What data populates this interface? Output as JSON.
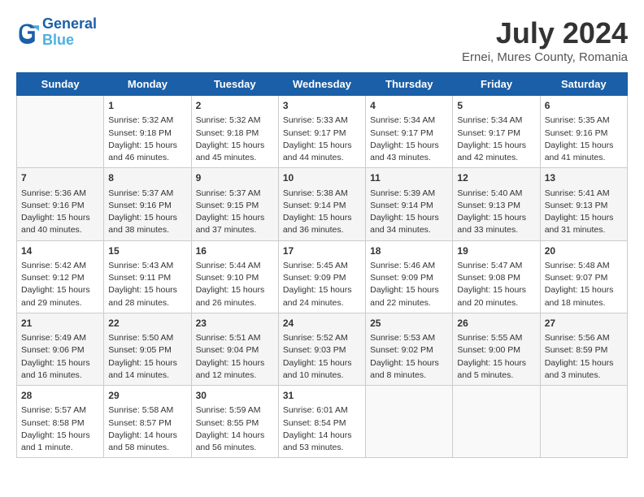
{
  "header": {
    "logo_line1": "General",
    "logo_line2": "Blue",
    "month_year": "July 2024",
    "location": "Ernei, Mures County, Romania"
  },
  "weekdays": [
    "Sunday",
    "Monday",
    "Tuesday",
    "Wednesday",
    "Thursday",
    "Friday",
    "Saturday"
  ],
  "weeks": [
    [
      {
        "day": "",
        "empty": true
      },
      {
        "day": "1",
        "sunrise": "5:32 AM",
        "sunset": "9:18 PM",
        "daylight": "15 hours and 46 minutes."
      },
      {
        "day": "2",
        "sunrise": "5:32 AM",
        "sunset": "9:18 PM",
        "daylight": "15 hours and 45 minutes."
      },
      {
        "day": "3",
        "sunrise": "5:33 AM",
        "sunset": "9:17 PM",
        "daylight": "15 hours and 44 minutes."
      },
      {
        "day": "4",
        "sunrise": "5:34 AM",
        "sunset": "9:17 PM",
        "daylight": "15 hours and 43 minutes."
      },
      {
        "day": "5",
        "sunrise": "5:34 AM",
        "sunset": "9:17 PM",
        "daylight": "15 hours and 42 minutes."
      },
      {
        "day": "6",
        "sunrise": "5:35 AM",
        "sunset": "9:16 PM",
        "daylight": "15 hours and 41 minutes."
      }
    ],
    [
      {
        "day": "7",
        "sunrise": "5:36 AM",
        "sunset": "9:16 PM",
        "daylight": "15 hours and 40 minutes."
      },
      {
        "day": "8",
        "sunrise": "5:37 AM",
        "sunset": "9:16 PM",
        "daylight": "15 hours and 38 minutes."
      },
      {
        "day": "9",
        "sunrise": "5:37 AM",
        "sunset": "9:15 PM",
        "daylight": "15 hours and 37 minutes."
      },
      {
        "day": "10",
        "sunrise": "5:38 AM",
        "sunset": "9:14 PM",
        "daylight": "15 hours and 36 minutes."
      },
      {
        "day": "11",
        "sunrise": "5:39 AM",
        "sunset": "9:14 PM",
        "daylight": "15 hours and 34 minutes."
      },
      {
        "day": "12",
        "sunrise": "5:40 AM",
        "sunset": "9:13 PM",
        "daylight": "15 hours and 33 minutes."
      },
      {
        "day": "13",
        "sunrise": "5:41 AM",
        "sunset": "9:13 PM",
        "daylight": "15 hours and 31 minutes."
      }
    ],
    [
      {
        "day": "14",
        "sunrise": "5:42 AM",
        "sunset": "9:12 PM",
        "daylight": "15 hours and 29 minutes."
      },
      {
        "day": "15",
        "sunrise": "5:43 AM",
        "sunset": "9:11 PM",
        "daylight": "15 hours and 28 minutes."
      },
      {
        "day": "16",
        "sunrise": "5:44 AM",
        "sunset": "9:10 PM",
        "daylight": "15 hours and 26 minutes."
      },
      {
        "day": "17",
        "sunrise": "5:45 AM",
        "sunset": "9:09 PM",
        "daylight": "15 hours and 24 minutes."
      },
      {
        "day": "18",
        "sunrise": "5:46 AM",
        "sunset": "9:09 PM",
        "daylight": "15 hours and 22 minutes."
      },
      {
        "day": "19",
        "sunrise": "5:47 AM",
        "sunset": "9:08 PM",
        "daylight": "15 hours and 20 minutes."
      },
      {
        "day": "20",
        "sunrise": "5:48 AM",
        "sunset": "9:07 PM",
        "daylight": "15 hours and 18 minutes."
      }
    ],
    [
      {
        "day": "21",
        "sunrise": "5:49 AM",
        "sunset": "9:06 PM",
        "daylight": "15 hours and 16 minutes."
      },
      {
        "day": "22",
        "sunrise": "5:50 AM",
        "sunset": "9:05 PM",
        "daylight": "15 hours and 14 minutes."
      },
      {
        "day": "23",
        "sunrise": "5:51 AM",
        "sunset": "9:04 PM",
        "daylight": "15 hours and 12 minutes."
      },
      {
        "day": "24",
        "sunrise": "5:52 AM",
        "sunset": "9:03 PM",
        "daylight": "15 hours and 10 minutes."
      },
      {
        "day": "25",
        "sunrise": "5:53 AM",
        "sunset": "9:02 PM",
        "daylight": "15 hours and 8 minutes."
      },
      {
        "day": "26",
        "sunrise": "5:55 AM",
        "sunset": "9:00 PM",
        "daylight": "15 hours and 5 minutes."
      },
      {
        "day": "27",
        "sunrise": "5:56 AM",
        "sunset": "8:59 PM",
        "daylight": "15 hours and 3 minutes."
      }
    ],
    [
      {
        "day": "28",
        "sunrise": "5:57 AM",
        "sunset": "8:58 PM",
        "daylight": "15 hours and 1 minute."
      },
      {
        "day": "29",
        "sunrise": "5:58 AM",
        "sunset": "8:57 PM",
        "daylight": "14 hours and 58 minutes."
      },
      {
        "day": "30",
        "sunrise": "5:59 AM",
        "sunset": "8:55 PM",
        "daylight": "14 hours and 56 minutes."
      },
      {
        "day": "31",
        "sunrise": "6:01 AM",
        "sunset": "8:54 PM",
        "daylight": "14 hours and 53 minutes."
      },
      {
        "day": "",
        "empty": true
      },
      {
        "day": "",
        "empty": true
      },
      {
        "day": "",
        "empty": true
      }
    ]
  ],
  "labels": {
    "sunrise": "Sunrise:",
    "sunset": "Sunset:",
    "daylight": "Daylight:"
  }
}
